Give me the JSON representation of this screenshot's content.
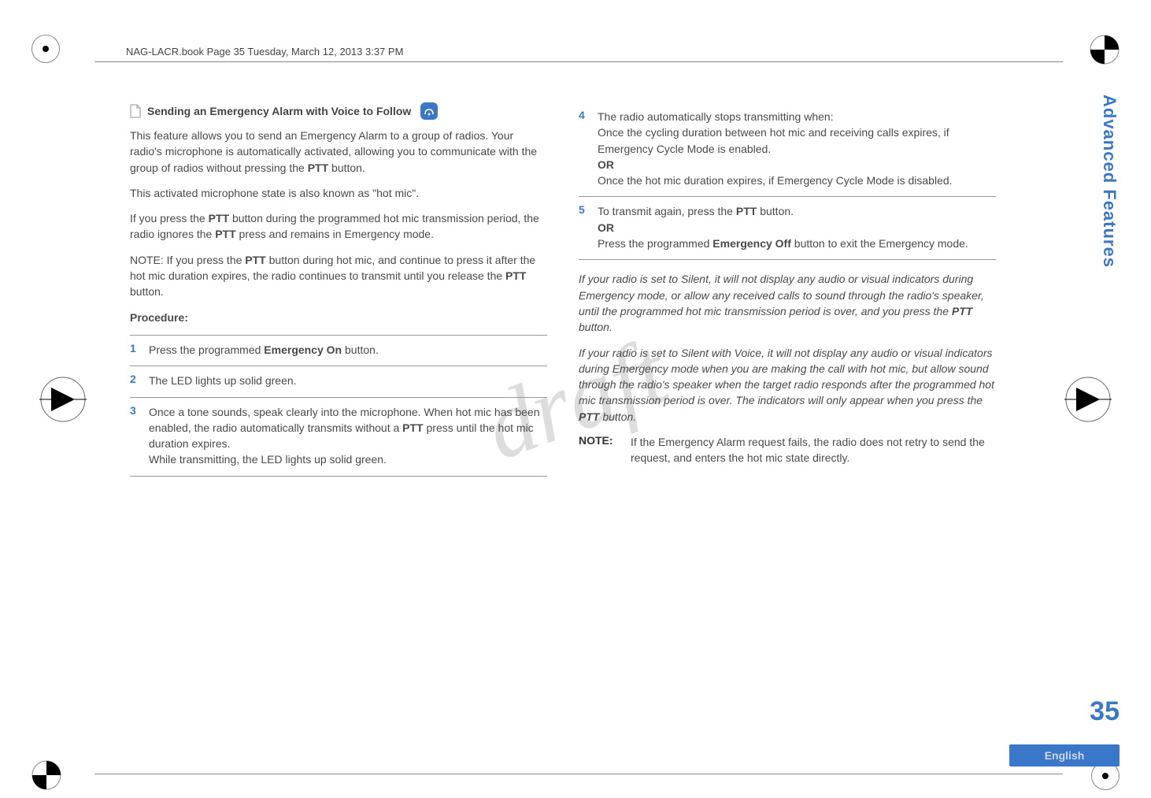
{
  "header_path": "NAG-LACR.book  Page 35  Tuesday, March 12, 2013  3:37 PM",
  "watermark": "draft",
  "left": {
    "section_title": "Sending an Emergency Alarm with Voice to Follow",
    "p1_a": "This feature allows you to send an Emergency Alarm to a group of radios. Your radio's microphone is automatically activated, allowing you to communicate with the group of radios without pressing the ",
    "p1_ptt": "PTT",
    "p1_b": " button.",
    "p2": "This activated microphone state is also known as \"hot mic\".",
    "p3_a": "If you press the ",
    "p3_b": " button during the programmed hot mic transmission period, the radio ignores the ",
    "p3_c": " press and remains in Emergency mode.",
    "p4_a": "NOTE:  If you press the ",
    "p4_b": " button during hot mic, and continue to press it after the hot mic duration expires, the radio continues to transmit until you release the ",
    "p4_c": " button.",
    "procedure_label": "Procedure:",
    "steps": {
      "s1_num": "1",
      "s1_a": "Press the programmed ",
      "s1_bold": "Emergency On",
      "s1_b": " button.",
      "s2_num": "2",
      "s2": "The LED lights up solid green.",
      "s3_num": "3",
      "s3_a": "Once a tone sounds, speak clearly into the microphone. When hot mic has been enabled, the radio automatically transmits without a ",
      "s3_b": " press until the hot mic duration expires.",
      "s3_c": "While transmitting, the LED lights up solid green."
    }
  },
  "right": {
    "s4_num": "4",
    "s4_a": "The radio automatically stops transmitting when:",
    "s4_b": "Once the cycling duration between hot mic and receiving calls expires, if Emergency Cycle Mode is enabled.",
    "s4_or": "OR",
    "s4_c": "Once the hot mic duration expires, if Emergency Cycle Mode is disabled.",
    "s5_num": "5",
    "s5_a": "To transmit again, press the ",
    "s5_b": " button.",
    "s5_or": "OR",
    "s5_c": "Press the programmed ",
    "s5_bold": "Emergency Off",
    "s5_d": " button to exit the Emergency mode.",
    "italic1_a": "If your radio is set to Silent, it will not display any audio or visual indicators during Emergency mode, or allow any received calls to sound through the radio's speaker, until the programmed hot mic transmission period is over, and you press the ",
    "italic1_b": " button.",
    "italic2_a": "If your radio is set to Silent with Voice, it will not display any audio or visual indicators during Emergency mode when you are making the call with hot mic, but allow sound through the radio's speaker when the target radio responds after the programmed hot mic transmission period is over. The indicators will only appear when you press the ",
    "italic2_b": " button.",
    "note_label": "NOTE:",
    "note_text": "If the Emergency Alarm request fails, the radio does not retry to send the request, and enters the hot mic state directly."
  },
  "ptt": "PTT",
  "sidebar": "Advanced Features",
  "page_number": "35",
  "language": "English"
}
